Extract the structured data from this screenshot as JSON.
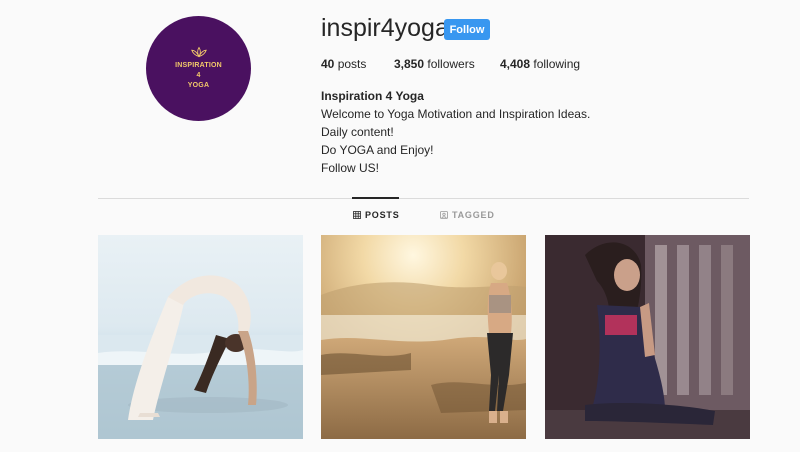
{
  "profile": {
    "avatar_line1": "INSPIRATION",
    "avatar_line2": "4",
    "avatar_line3": "YOGA",
    "username": "inspir4yoga",
    "follow_label": "Follow",
    "stats": {
      "posts_count": "40",
      "posts_label": "posts",
      "followers_count": "3,850",
      "followers_label": "followers",
      "following_count": "4,408",
      "following_label": "following"
    },
    "bio": {
      "full_name": "Inspiration 4 Yoga",
      "line1": "Welcome to Yoga Motivation and Inspiration Ideas.",
      "line2": "Daily content!",
      "line3": "Do YOGA and Enjoy!",
      "line4": "Follow US!"
    }
  },
  "tabs": {
    "posts": {
      "label": "POSTS",
      "icon": "grid-icon"
    },
    "tagged": {
      "label": "TAGGED",
      "icon": "tag-icon"
    }
  },
  "posts": [
    {
      "name": "post-backbend-beach",
      "description_icon": "photo"
    },
    {
      "name": "post-standing-sunset",
      "description_icon": "photo"
    },
    {
      "name": "post-seated-window",
      "description_icon": "photo"
    }
  ],
  "colors": {
    "accent": "#3897f0",
    "avatar_bg": "#4a1160",
    "avatar_text": "#f3c96a"
  }
}
